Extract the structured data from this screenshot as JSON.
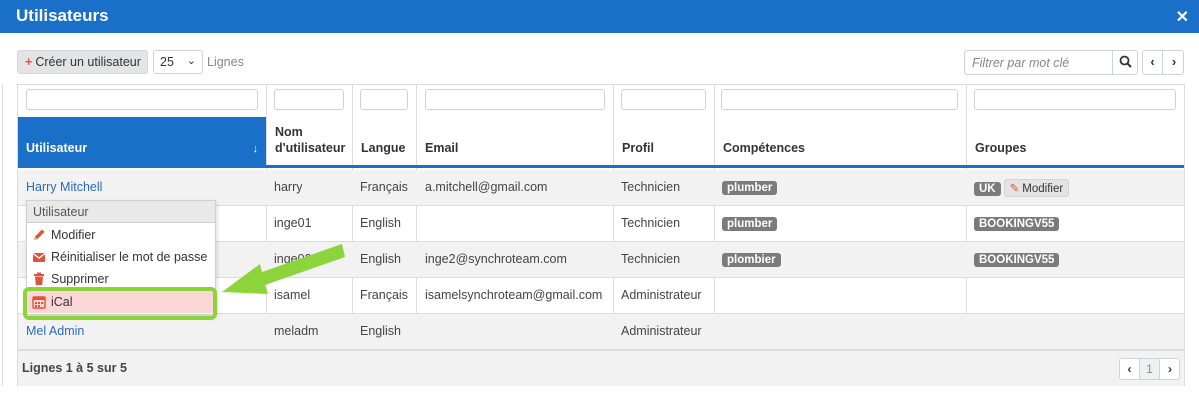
{
  "window": {
    "title": "Utilisateurs",
    "close_icon": "✕"
  },
  "toolbar": {
    "create_label": "Créer un utilisateur",
    "rows_value": "25",
    "rows_label": "Lignes",
    "search_placeholder": "Filtrer par mot clé"
  },
  "table": {
    "columns": [
      "Utilisateur",
      "Nom d'utilisateur",
      "Langue",
      "Email",
      "Profil",
      "Compétences",
      "Groupes"
    ],
    "sorted_column": "Utilisateur",
    "rows": [
      {
        "utilisateur": "Harry Mitchell",
        "login": "harry",
        "langue": "Français",
        "email": "a.mitchell@gmail.com",
        "profil": "Technicien",
        "competences": "plumber",
        "groupes": [
          "UK"
        ],
        "group_action": "Modifier"
      },
      {
        "utilisateur": "",
        "login": "inge01",
        "langue": "English",
        "email": "",
        "profil": "Technicien",
        "competences": "plumber",
        "groupes": [
          "BOOKINGV55"
        ]
      },
      {
        "utilisateur": "",
        "login": "inge02",
        "langue": "English",
        "email": "inge2@synchroteam.com",
        "profil": "Technicien",
        "competences": "plombier",
        "groupes": [
          "BOOKINGV55"
        ]
      },
      {
        "utilisateur": "",
        "login": "isamel",
        "langue": "Français",
        "email": "isamelsynchroteam@gmail.com",
        "profil": "Administrateur",
        "competences": "",
        "groupes": []
      },
      {
        "utilisateur": "Mel Admin",
        "login": "meladm",
        "langue": "English",
        "email": "",
        "profil": "Administrateur",
        "competences": "",
        "groupes": []
      }
    ]
  },
  "footer": {
    "count_label": "Lignes 1 à 5 sur 5",
    "page": "1"
  },
  "context_menu": {
    "header": "Utilisateur",
    "items": [
      {
        "label": "Modifier",
        "icon": "pencil-icon"
      },
      {
        "label": "Réinitialiser le mot de passe",
        "icon": "envelope-icon"
      },
      {
        "label": "Supprimer",
        "icon": "trash-icon"
      },
      {
        "label": "iCal",
        "icon": "calendar-icon",
        "highlighted": true
      }
    ]
  },
  "colors": {
    "accent": "#1a6fc9",
    "highlight_frame": "#8cd43a",
    "badge": "#7b7b7b",
    "danger": "#d9534f"
  }
}
